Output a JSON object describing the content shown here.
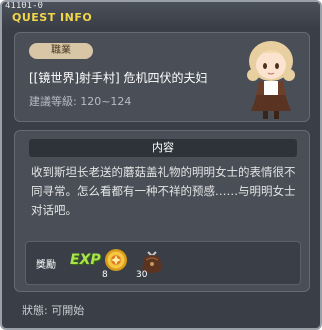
{
  "window": {
    "quest_id": "41101-0",
    "title": "QUEST INFO"
  },
  "header": {
    "job_label": "職業",
    "quest_name": "[[镜世界]射手村] 危机四伏的夫妇",
    "level_text": "建議等級: 120~124",
    "npc_icon": "npc-girl-portrait"
  },
  "content": {
    "heading": "内容",
    "body": "收到斯坦长老送的蘑菇盖礼物的明明女士的表情很不同寻常。怎么看都有一种不祥的预感……与明明女士对话吧。"
  },
  "rewards": {
    "label": "獎勵",
    "exp_label": "EXP",
    "items": [
      {
        "icon": "gold-medal-icon",
        "count": "8"
      },
      {
        "icon": "leather-bag-icon",
        "count": "30"
      }
    ]
  },
  "footer": {
    "status": "狀態: 可開始"
  }
}
